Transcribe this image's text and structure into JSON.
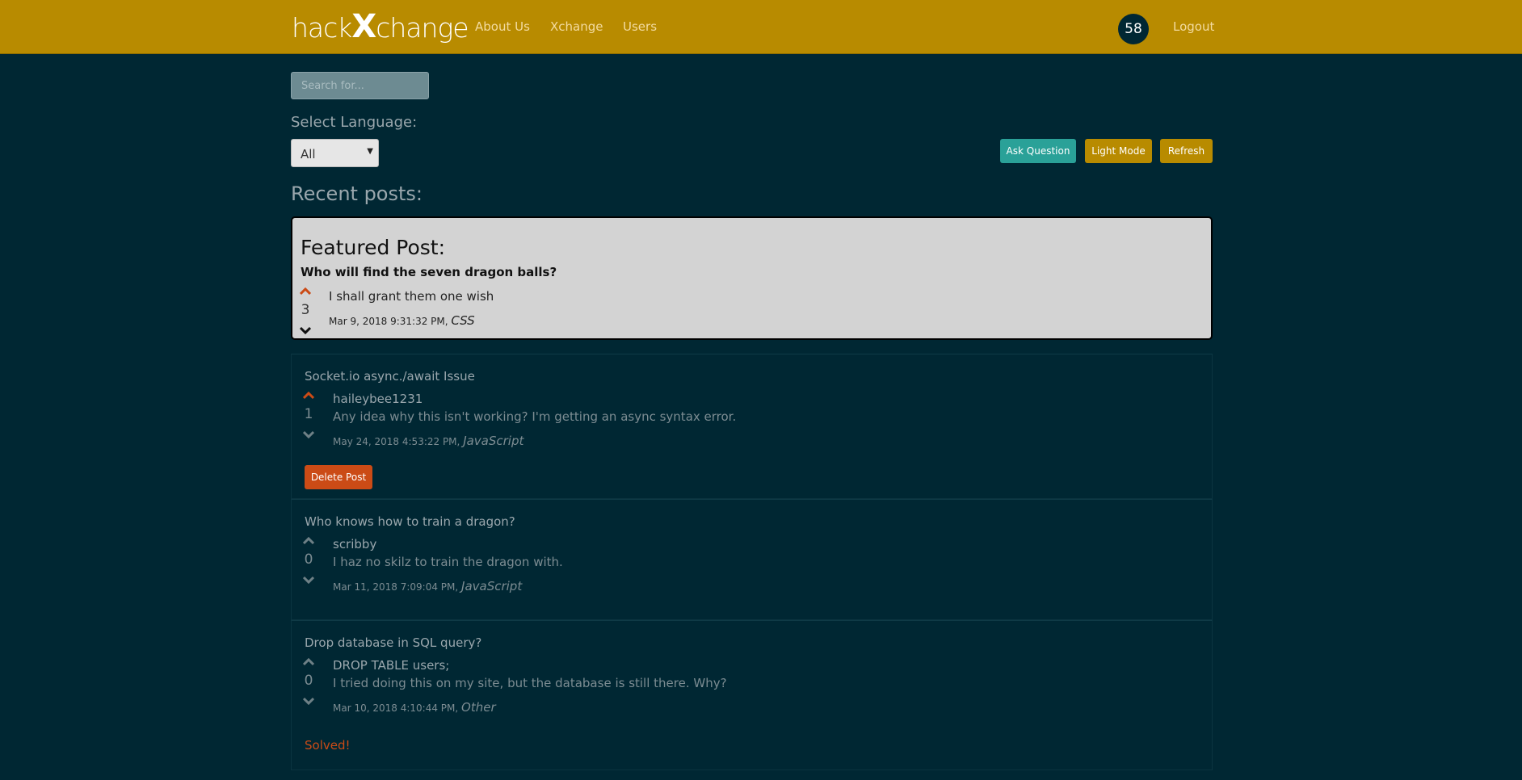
{
  "nav": {
    "brand_left": "hack",
    "brand_x": "X",
    "brand_right": "change",
    "links": [
      "About Us",
      "Xchange",
      "Users"
    ],
    "badge": "58",
    "logout": "Logout"
  },
  "search": {
    "placeholder": "Search for..."
  },
  "language": {
    "label": "Select Language:",
    "selected": "All"
  },
  "buttons": {
    "ask": "Ask Question",
    "mode": "Light Mode",
    "refresh": "Refresh"
  },
  "recent_title": "Recent posts:",
  "featured": {
    "heading": "Featured Post:",
    "title": "Who will find the seven dragon balls?",
    "votes": "3",
    "body": "I shall grant them one wish",
    "date": "Mar 9, 2018 9:31:32 PM,",
    "lang": "CSS"
  },
  "posts": [
    {
      "title": "Socket.io async./await Issue",
      "votes": "1",
      "user": "haileybee1231",
      "body": "Any idea why this isn't working? I'm getting an async syntax error.",
      "date": "May 24, 2018 4:53:22 PM,",
      "lang": "JavaScript",
      "action": "Delete Post"
    },
    {
      "title": "Who knows how to train a dragon?",
      "votes": "0",
      "user": "scribby",
      "body": "I haz no skilz to train the dragon with.",
      "date": "Mar 11, 2018 7:09:04 PM,",
      "lang": "JavaScript"
    },
    {
      "title": "Drop database in SQL query?",
      "votes": "0",
      "user": "DROP TABLE users;",
      "body": "I tried doing this on my site, but the database is still there. Why?",
      "date": "Mar 10, 2018 4:10:44 PM,",
      "lang": "Other",
      "status": "Solved!"
    }
  ],
  "colors": {
    "background": "#002733",
    "navbar": "#b88b00",
    "accent_teal": "#2aa198",
    "danger": "#cb4b16",
    "upvoted": "#cb4b16"
  }
}
